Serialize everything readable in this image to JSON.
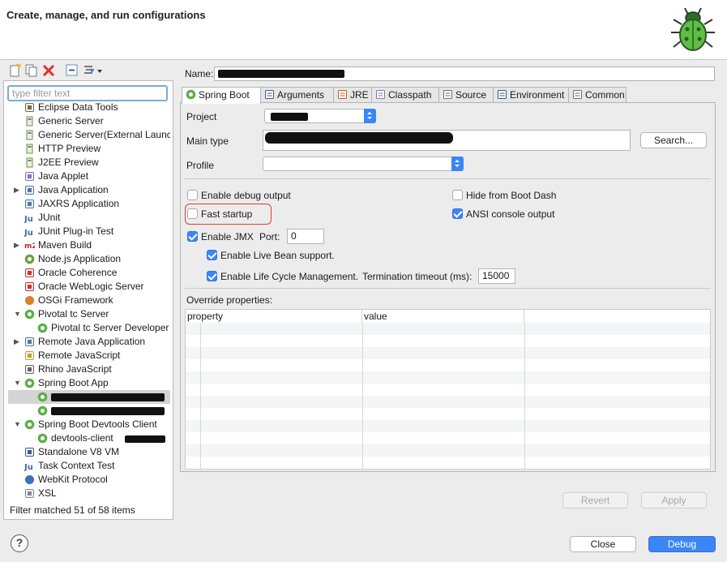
{
  "header": {
    "title": "Create, manage, and run configurations"
  },
  "left": {
    "filter_placeholder": "type filter text",
    "status": "Filter matched 51 of 58 items",
    "tree": [
      {
        "label": "Eclipse Data Tools",
        "indent": 1,
        "icon": "data-tools-icon",
        "color": "#7b6a4a"
      },
      {
        "label": "Generic Server",
        "indent": 1,
        "icon": "server-icon",
        "color": "#6b8e4e"
      },
      {
        "label": "Generic Server(External Launc",
        "indent": 1,
        "icon": "server-icon",
        "color": "#6b8e4e"
      },
      {
        "label": "HTTP Preview",
        "indent": 1,
        "icon": "server-icon",
        "color": "#6b8e4e"
      },
      {
        "label": "J2EE Preview",
        "indent": 1,
        "icon": "server-icon",
        "color": "#6b8e4e"
      },
      {
        "label": "Java Applet",
        "indent": 1,
        "icon": "applet-icon",
        "color": "#8a6fb5"
      },
      {
        "label": "Java Application",
        "indent": 1,
        "icon": "java-app-icon",
        "color": "#4a78b5",
        "arrow": "right"
      },
      {
        "label": "JAXRS Application",
        "indent": 1,
        "icon": "jaxrs-icon",
        "color": "#4a78b5"
      },
      {
        "label": "JUnit",
        "indent": 1,
        "icon": "junit-icon",
        "color": "#3d6aa8"
      },
      {
        "label": "JUnit Plug-in Test",
        "indent": 1,
        "icon": "junit-plugin-icon",
        "color": "#3d6aa8"
      },
      {
        "label": "Maven Build",
        "indent": 1,
        "icon": "maven-icon",
        "color": "#c0282c",
        "arrow": "right"
      },
      {
        "label": "Node.js Application",
        "indent": 1,
        "icon": "nodejs-icon",
        "color": "#6aa13a"
      },
      {
        "label": "Oracle Coherence",
        "indent": 1,
        "icon": "coherence-icon",
        "color": "#d0312d"
      },
      {
        "label": "Oracle WebLogic Server",
        "indent": 1,
        "icon": "weblogic-icon",
        "color": "#d0312d"
      },
      {
        "label": "OSGi Framework",
        "indent": 1,
        "icon": "osgi-icon",
        "color": "#d9822b"
      },
      {
        "label": "Pivotal tc Server",
        "indent": 1,
        "icon": "pivotal-icon",
        "color": "#5bb048",
        "arrow": "down"
      },
      {
        "label": "Pivotal tc Server Developer",
        "indent": 2,
        "icon": "pivotal-icon",
        "color": "#5bb048"
      },
      {
        "label": "Remote Java Application",
        "indent": 1,
        "icon": "remote-java-icon",
        "color": "#4a78b5",
        "arrow": "right"
      },
      {
        "label": "Remote JavaScript",
        "indent": 1,
        "icon": "remote-js-icon",
        "color": "#c9a227"
      },
      {
        "label": "Rhino JavaScript",
        "indent": 1,
        "icon": "rhino-icon",
        "color": "#666666"
      },
      {
        "label": "Spring Boot App",
        "indent": 1,
        "icon": "spring-boot-icon",
        "color": "#5bb048",
        "arrow": "down"
      },
      {
        "label": "",
        "indent": 2,
        "icon": "spring-boot-icon",
        "color": "#5bb048",
        "selected": true,
        "redacted": true
      },
      {
        "label": "",
        "indent": 2,
        "icon": "spring-boot-icon",
        "color": "#5bb048",
        "redacted": true
      },
      {
        "label": "Spring Boot Devtools Client",
        "indent": 1,
        "icon": "devtools-icon",
        "color": "#5bb048",
        "arrow": "down"
      },
      {
        "label": "devtools-client",
        "indent": 2,
        "icon": "devtools-icon",
        "color": "#5bb048",
        "redacted_tail": true
      },
      {
        "label": "Standalone V8 VM",
        "indent": 1,
        "icon": "v8-icon",
        "color": "#3a5c8c"
      },
      {
        "label": "Task Context Test",
        "indent": 1,
        "icon": "task-context-icon",
        "color": "#3d6aa8"
      },
      {
        "label": "WebKit Protocol",
        "indent": 1,
        "icon": "webkit-icon",
        "color": "#3a6fc4"
      },
      {
        "label": "XSL",
        "indent": 1,
        "icon": "xsl-icon",
        "color": "#888888"
      }
    ]
  },
  "right": {
    "name_label": "Name:",
    "tabs": [
      {
        "label": "Spring Boot",
        "icon": "spring-boot-icon",
        "active": true
      },
      {
        "label": "Arguments",
        "icon": "arguments-icon"
      },
      {
        "label": "JRE",
        "icon": "jre-icon"
      },
      {
        "label": "Classpath",
        "icon": "classpath-icon"
      },
      {
        "label": "Source",
        "icon": "source-icon"
      },
      {
        "label": "Environment",
        "icon": "environment-icon"
      },
      {
        "label": "Common",
        "icon": "common-icon"
      }
    ],
    "project_label": "Project",
    "main_type_label": "Main type",
    "search_button": "Search...",
    "profile_label": "Profile",
    "enable_debug_output": "Enable debug output",
    "hide_from_boot_dash": "Hide from Boot Dash",
    "fast_startup": "Fast startup",
    "ansi_console_output": "ANSI console output",
    "enable_jmx": "Enable JMX",
    "port_label": "Port:",
    "port_value": "0",
    "enable_live_bean": "Enable Live Bean support.",
    "enable_lifecycle": "Enable Life Cycle Management.",
    "termination_timeout_label": "Termination timeout (ms):",
    "termination_timeout_value": "15000",
    "override_properties_label": "Override properties:",
    "table_headers": [
      "property",
      "value"
    ],
    "revert_button": "Revert",
    "apply_button": "Apply"
  },
  "checks": {
    "enable_debug_output": false,
    "hide_from_boot_dash": false,
    "fast_startup": false,
    "ansi_console_output": true,
    "enable_jmx": true,
    "enable_live_bean": true,
    "enable_lifecycle": true
  },
  "bottom": {
    "close_button": "Close",
    "debug_button": "Debug",
    "help_symbol": "?"
  },
  "colors": {
    "accent": "#3b86f7",
    "highlight_ring": "#e23b3b",
    "bug_green": "#4caf3a"
  }
}
